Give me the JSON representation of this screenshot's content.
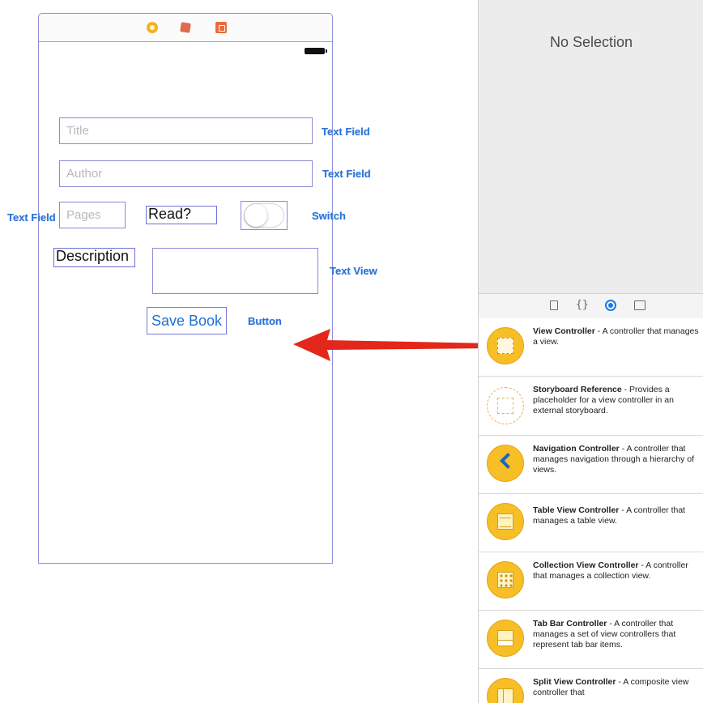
{
  "scene": {
    "fields": {
      "title_placeholder": "Title",
      "author_placeholder": "Author",
      "pages_placeholder": "Pages"
    },
    "labels": {
      "read": "Read?",
      "description": "Description"
    },
    "save_button": "Save Book",
    "tags": {
      "title_field": "Text Field",
      "author_field": "Text Field",
      "pages_field": "Text Field",
      "switch": "Switch",
      "text_view": "Text View",
      "button": "Button"
    },
    "switch_on": false
  },
  "inspector": {
    "no_selection": "No Selection"
  },
  "library_tabs": [
    "file-template-icon",
    "code-snippet-icon",
    "object-library-icon",
    "media-library-icon"
  ],
  "library": {
    "items": [
      {
        "name": "View Controller",
        "desc": " - A controller that manages a view."
      },
      {
        "name": "Storyboard Reference",
        "desc": " - Provides a placeholder for a view controller in an external storyboard."
      },
      {
        "name": "Navigation Controller",
        "desc": " - A controller that manages navigation through a hierarchy of views."
      },
      {
        "name": "Table View Controller",
        "desc": " - A controller that manages a table view."
      },
      {
        "name": "Collection View Controller",
        "desc": " - A controller that manages a collection view."
      },
      {
        "name": "Tab Bar Controller",
        "desc": " - A controller that manages a set of view controllers that represent tab bar items."
      },
      {
        "name": "Split View Controller",
        "desc": " - A composite view controller that"
      }
    ]
  },
  "colors": {
    "accent_blue": "#1f6fd8",
    "arrow_red": "#e3271b",
    "library_icon_yellow": "#f7bf25"
  }
}
